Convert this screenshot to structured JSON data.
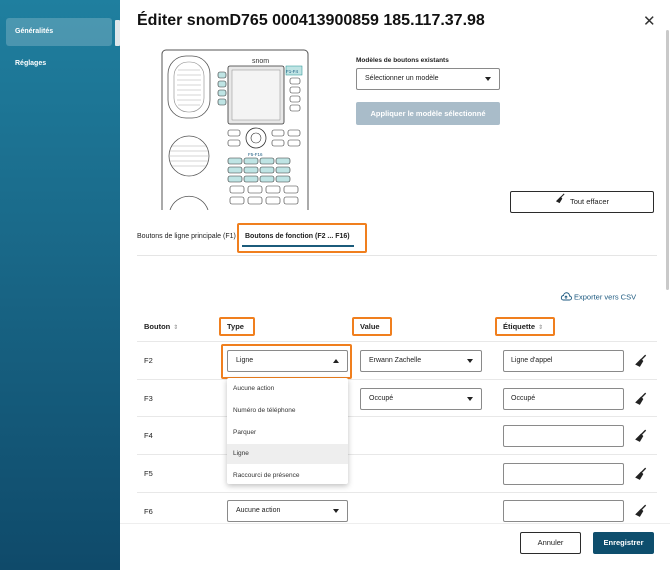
{
  "sidebar": {
    "items": [
      {
        "label": "Généralités",
        "active": true
      },
      {
        "label": "Réglages",
        "active": false
      }
    ]
  },
  "dialog": {
    "title": "Éditer snomD765 000413900859 185.117.37.98",
    "close_icon": "close-icon"
  },
  "phone": {
    "brand": "snom",
    "key_label_top": "F1-F4",
    "key_label_mid": "F5-F16"
  },
  "models": {
    "label": "Modèles de boutons existants",
    "select_value": "Sélectionner un modèle",
    "apply_label": "Appliquer le modèle sélectionné"
  },
  "clear_all_label": "Tout effacer",
  "tabs": [
    {
      "label": "Boutons de ligne principale (F1)",
      "active": false
    },
    {
      "label": "Boutons de fonction (F2 ... F16)",
      "active": true
    }
  ],
  "export_label": "Exporter vers CSV",
  "table": {
    "headers": {
      "button": "Bouton",
      "type": "Type",
      "value": "Value",
      "label": "Étiquette"
    },
    "rows": [
      {
        "button": "F2",
        "type": "Ligne",
        "value": "Erwann Zachelle",
        "label": "Ligne d'appel"
      },
      {
        "button": "F3",
        "type": "",
        "value": "Occupé",
        "label": "Occupé"
      },
      {
        "button": "F4",
        "type": "",
        "value": "",
        "label": ""
      },
      {
        "button": "F5",
        "type": "",
        "value": "",
        "label": ""
      },
      {
        "button": "F6",
        "type": "Aucune action",
        "value": "",
        "label": ""
      }
    ]
  },
  "type_menu": {
    "options": [
      "Aucune action",
      "Numéro de téléphone",
      "Parquer",
      "Ligne",
      "Raccourci de présence"
    ],
    "hovered": "Ligne"
  },
  "footer": {
    "cancel_label": "Annuler",
    "save_label": "Enregistrer"
  },
  "colors": {
    "primary": "#0e4e6d",
    "highlight": "#f07f1e",
    "sidebar": "#1a6a8a"
  }
}
